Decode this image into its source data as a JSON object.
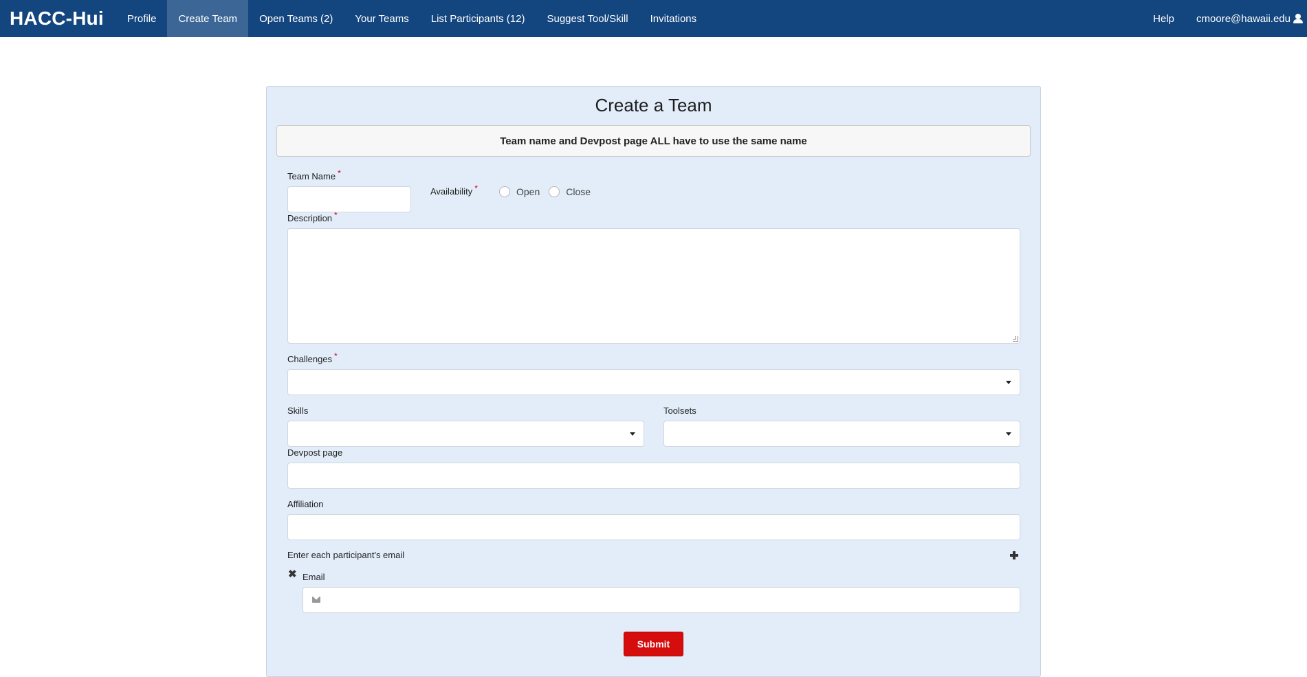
{
  "navbar": {
    "brand": "HACC-Hui",
    "items": [
      {
        "label": "Profile"
      },
      {
        "label": "Create Team"
      },
      {
        "label": "Open Teams (2)"
      },
      {
        "label": "Your Teams"
      },
      {
        "label": "List Participants (12)"
      },
      {
        "label": "Suggest Tool/Skill"
      },
      {
        "label": "Invitations"
      }
    ],
    "active": "Create Team",
    "help": "Help",
    "user": "cmoore@hawaii.edu",
    "user_icon": "user-icon"
  },
  "form": {
    "title": "Create a Team",
    "notice": "Team name and Devpost page ALL have to use the same name",
    "team_name": {
      "label": "Team Name",
      "required_mark": "*",
      "value": ""
    },
    "availability": {
      "label": "Availability",
      "required_mark": "*",
      "options": [
        "Open",
        "Close"
      ],
      "selected": ""
    },
    "description": {
      "label": "Description",
      "required_mark": "*",
      "value": ""
    },
    "challenges": {
      "label": "Challenges",
      "required_mark": "*",
      "value": ""
    },
    "skills": {
      "label": "Skills",
      "value": ""
    },
    "toolsets": {
      "label": "Toolsets",
      "value": ""
    },
    "devpost": {
      "label": "Devpost page",
      "value": ""
    },
    "affiliation": {
      "label": "Affiliation",
      "value": ""
    },
    "participants": {
      "label": "Enter each participant's email",
      "add_icon": "plus-icon",
      "remove_icon": "close-icon"
    },
    "email": {
      "label": "Email",
      "value": "",
      "icon": "envelope-icon"
    },
    "submit_label": "Submit"
  },
  "colors": {
    "navbar": "#13457f",
    "nav_active": "#3b6696",
    "card_bg": "#e2edf9",
    "submit": "#d50d0d",
    "required": "#d0021b"
  }
}
